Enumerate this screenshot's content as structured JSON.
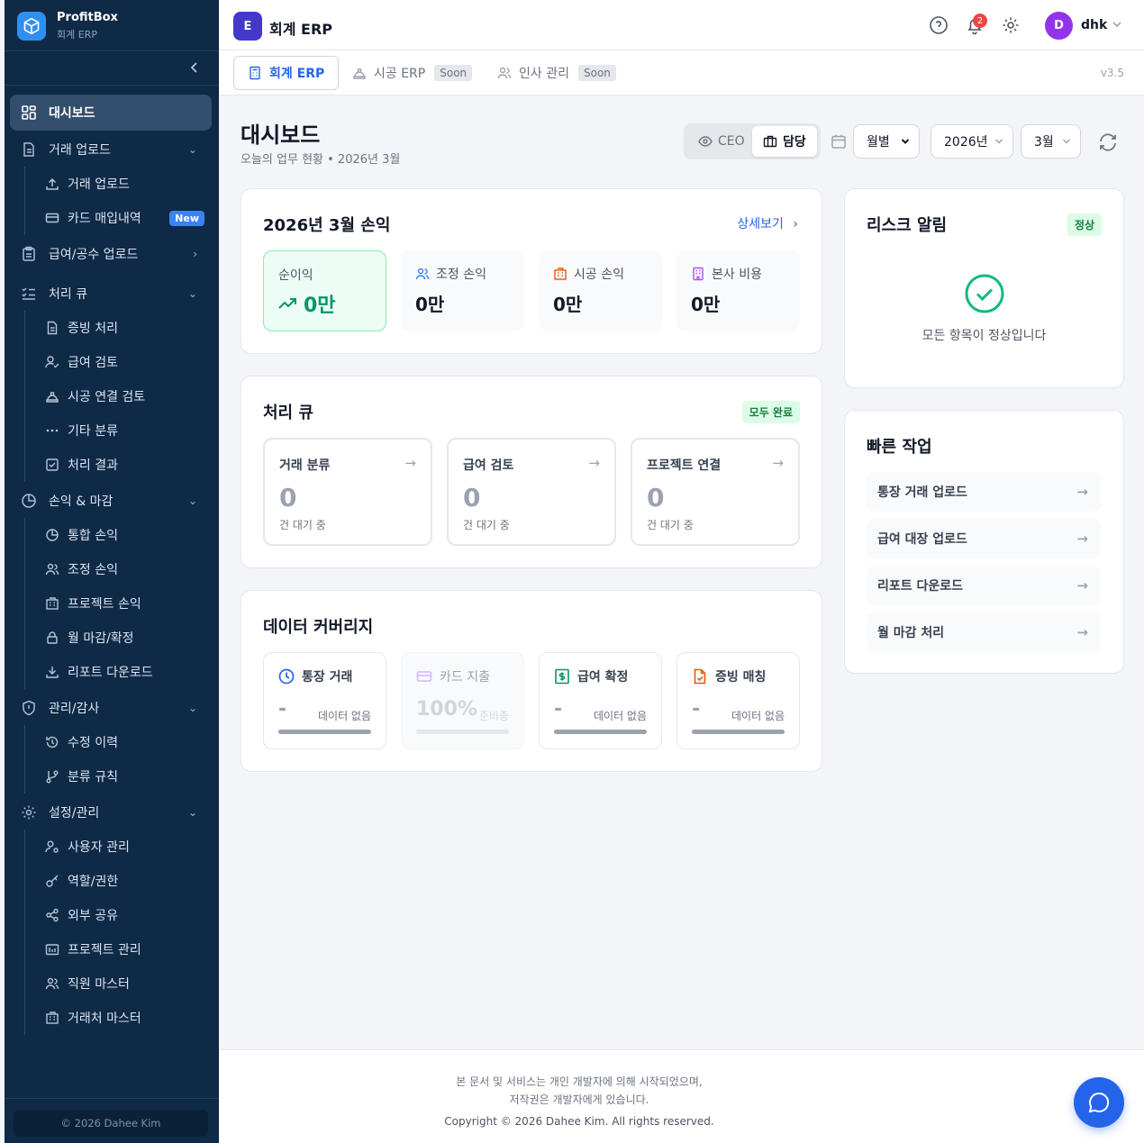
{
  "brand": {
    "name": "ProfitBox",
    "subtitle": "회계 ERP"
  },
  "sidebar": {
    "collapse_icon": "chevron-left-icon",
    "items": [
      {
        "label": "대시보드",
        "icon": "dashboard-grid-icon",
        "active": true
      },
      {
        "label": "거래 업로드",
        "icon": "file-icon",
        "expanded": true,
        "children": [
          {
            "label": "거래 업로드",
            "icon": "upload-icon"
          },
          {
            "label": "카드 매입내역",
            "icon": "credit-card-icon",
            "badge": "New"
          }
        ]
      },
      {
        "label": "급여/공수 업로드",
        "icon": "clipboard-icon",
        "expanded": false
      },
      {
        "label": "처리 큐",
        "icon": "checklist-icon",
        "expanded": true,
        "children": [
          {
            "label": "증빙 처리",
            "icon": "document-icon"
          },
          {
            "label": "급여 검토",
            "icon": "user-check-icon"
          },
          {
            "label": "시공 연결 검토",
            "icon": "hard-hat-icon"
          },
          {
            "label": "기타 분류",
            "icon": "more-icon"
          },
          {
            "label": "처리 결과",
            "icon": "check-square-icon"
          }
        ]
      },
      {
        "label": "손익 & 마감",
        "icon": "pie-chart-icon",
        "expanded": true,
        "children": [
          {
            "label": "통합 손익",
            "icon": "pie-chart-icon"
          },
          {
            "label": "조정 손익",
            "icon": "users-icon"
          },
          {
            "label": "프로젝트 손익",
            "icon": "building-icon"
          },
          {
            "label": "월 마감/확정",
            "icon": "lock-icon"
          },
          {
            "label": "리포트 다운로드",
            "icon": "download-icon"
          }
        ]
      },
      {
        "label": "관리/감사",
        "icon": "shield-icon",
        "expanded": true,
        "children": [
          {
            "label": "수정 이력",
            "icon": "history-icon"
          },
          {
            "label": "분류 규칙",
            "icon": "git-branch-icon"
          }
        ]
      },
      {
        "label": "설정/관리",
        "icon": "gear-icon",
        "expanded": true,
        "children": [
          {
            "label": "사용자 관리",
            "icon": "user-cog-icon"
          },
          {
            "label": "역할/권한",
            "icon": "key-icon"
          },
          {
            "label": "외부 공유",
            "icon": "share-icon"
          },
          {
            "label": "프로젝트 관리",
            "icon": "folder-icon"
          },
          {
            "label": "직원 마스터",
            "icon": "users-icon"
          },
          {
            "label": "거래처 마스터",
            "icon": "building-icon"
          }
        ]
      }
    ],
    "copyright": "© 2026 Dahee Kim"
  },
  "topbar": {
    "app_badge": "E",
    "title": "회계 ERP",
    "notifications": "2",
    "user_initial": "D",
    "user_name": "dhk"
  },
  "tabs": [
    {
      "label": "회계 ERP",
      "active": true,
      "icon": "calculator-icon"
    },
    {
      "label": "시공 ERP",
      "badge": "Soon",
      "icon": "hard-hat-icon"
    },
    {
      "label": "인사 관리",
      "badge": "Soon",
      "icon": "users-icon"
    }
  ],
  "version": "v3.5",
  "page": {
    "title": "대시보드",
    "subtitle": "오늘의 업무 현황 • 2026년 3월"
  },
  "view_toggle": {
    "ceo": "CEO",
    "staff": "담당",
    "selected": "담당"
  },
  "filters": {
    "period": "월별",
    "year": "2026년",
    "month": "3월"
  },
  "pl_card": {
    "title": "2026년 3월 손익",
    "detail_link": "상세보기",
    "boxes": [
      {
        "label": "순이익",
        "value": "0만",
        "icon": "trend-up-icon",
        "highlight": true
      },
      {
        "label": "조정 손익",
        "value": "0만",
        "icon": "users-icon"
      },
      {
        "label": "시공 손익",
        "value": "0만",
        "icon": "building-icon"
      },
      {
        "label": "본사 비용",
        "value": "0만",
        "icon": "office-icon"
      }
    ]
  },
  "queue_card": {
    "title": "처리 큐",
    "status": "모두 완료",
    "items": [
      {
        "label": "거래 분류",
        "count": "0",
        "sub": "건 대기 중"
      },
      {
        "label": "급여 검토",
        "count": "0",
        "sub": "건 대기 중"
      },
      {
        "label": "프로젝트 연결",
        "count": "0",
        "sub": "건 대기 중"
      }
    ]
  },
  "coverage_card": {
    "title": "데이터 커버리지",
    "items": [
      {
        "label": "통장 거래",
        "value": "-",
        "note": "데이터 없음",
        "icon": "clock-icon",
        "color": "#2563eb",
        "progress": 1.0
      },
      {
        "label": "카드 지출",
        "value": "100%",
        "note": "준비중",
        "icon": "credit-card-icon",
        "color": "#c084fc",
        "progress": 1.0,
        "disabled": true
      },
      {
        "label": "급여 확정",
        "value": "-",
        "note": "데이터 없음",
        "icon": "dollar-icon",
        "color": "#059669",
        "progress": 1.0
      },
      {
        "label": "증빙 매칭",
        "value": "-",
        "note": "데이터 없음",
        "icon": "file-check-icon",
        "color": "#ea580c",
        "progress": 1.0
      }
    ]
  },
  "risk_card": {
    "title": "리스크 알림",
    "status": "정상",
    "message": "모든 항목이 정상입니다"
  },
  "quick_card": {
    "title": "빠른 작업",
    "items": [
      "통장 거래 업로드",
      "급여 대장 업로드",
      "리포트 다운로드",
      "월 마감 처리"
    ]
  },
  "footer": {
    "line1": "본 문서 및 서비스는 개인 개발자에 의해 시작되었으며,",
    "line2": "저작권은 개발자에게 있습니다.",
    "line3": "Copyright © 2026 Dahee Kim. All rights reserved."
  }
}
